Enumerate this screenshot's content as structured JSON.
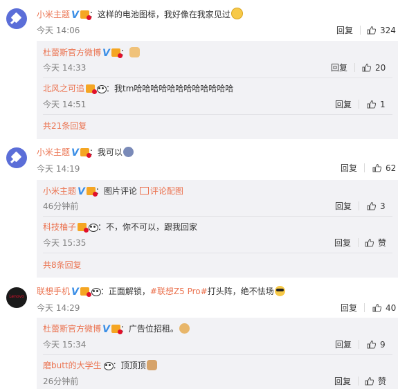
{
  "labels": {
    "reply": "回复",
    "like": "赞"
  },
  "comments": [
    {
      "author": "小米主题",
      "text_prefix": "：这样的电池图标，我好像在我家见过",
      "time": "今天 14:06",
      "likes": "324",
      "replies": [
        {
          "author": "杜蕾斯官方微博",
          "text_prefix": "：",
          "time": "今天 14:33",
          "likes": "20"
        },
        {
          "author": "北风之可追",
          "text_prefix": "：我tm哈哈哈哈哈哈哈哈哈哈哈哈",
          "time": "今天 14:51",
          "likes": "1"
        }
      ],
      "more": "共21条回复"
    },
    {
      "author": "小米主题",
      "text_prefix": "：我可以",
      "time": "今天 14:19",
      "likes": "62",
      "replies": [
        {
          "author": "小米主题",
          "text_prefix": "：图片评论",
          "pic_link": "评论配图",
          "time": "46分钟前",
          "likes": "3"
        },
        {
          "author": "科技柚子",
          "text_prefix": "：不，你不可以，跟我回家",
          "time": "今天 15:35",
          "likes": "赞"
        }
      ],
      "more": "共8条回复"
    },
    {
      "author": "联想手机",
      "avatar_text": "Lenovo",
      "text_prefix": "：正面解锁，",
      "hashtag": "#联想Z5 Pro#",
      "text_suffix": "打头阵，绝不怯场",
      "time": "今天 14:29",
      "likes": "40",
      "replies": [
        {
          "author": "杜蕾斯官方微博",
          "text_prefix": "：广告位招租。",
          "time": "今天 15:34",
          "likes": "9"
        },
        {
          "author": "磨butt的大学生",
          "text_prefix": "：顶顶顶",
          "time": "26分钟前",
          "likes": "赞"
        }
      ]
    }
  ]
}
